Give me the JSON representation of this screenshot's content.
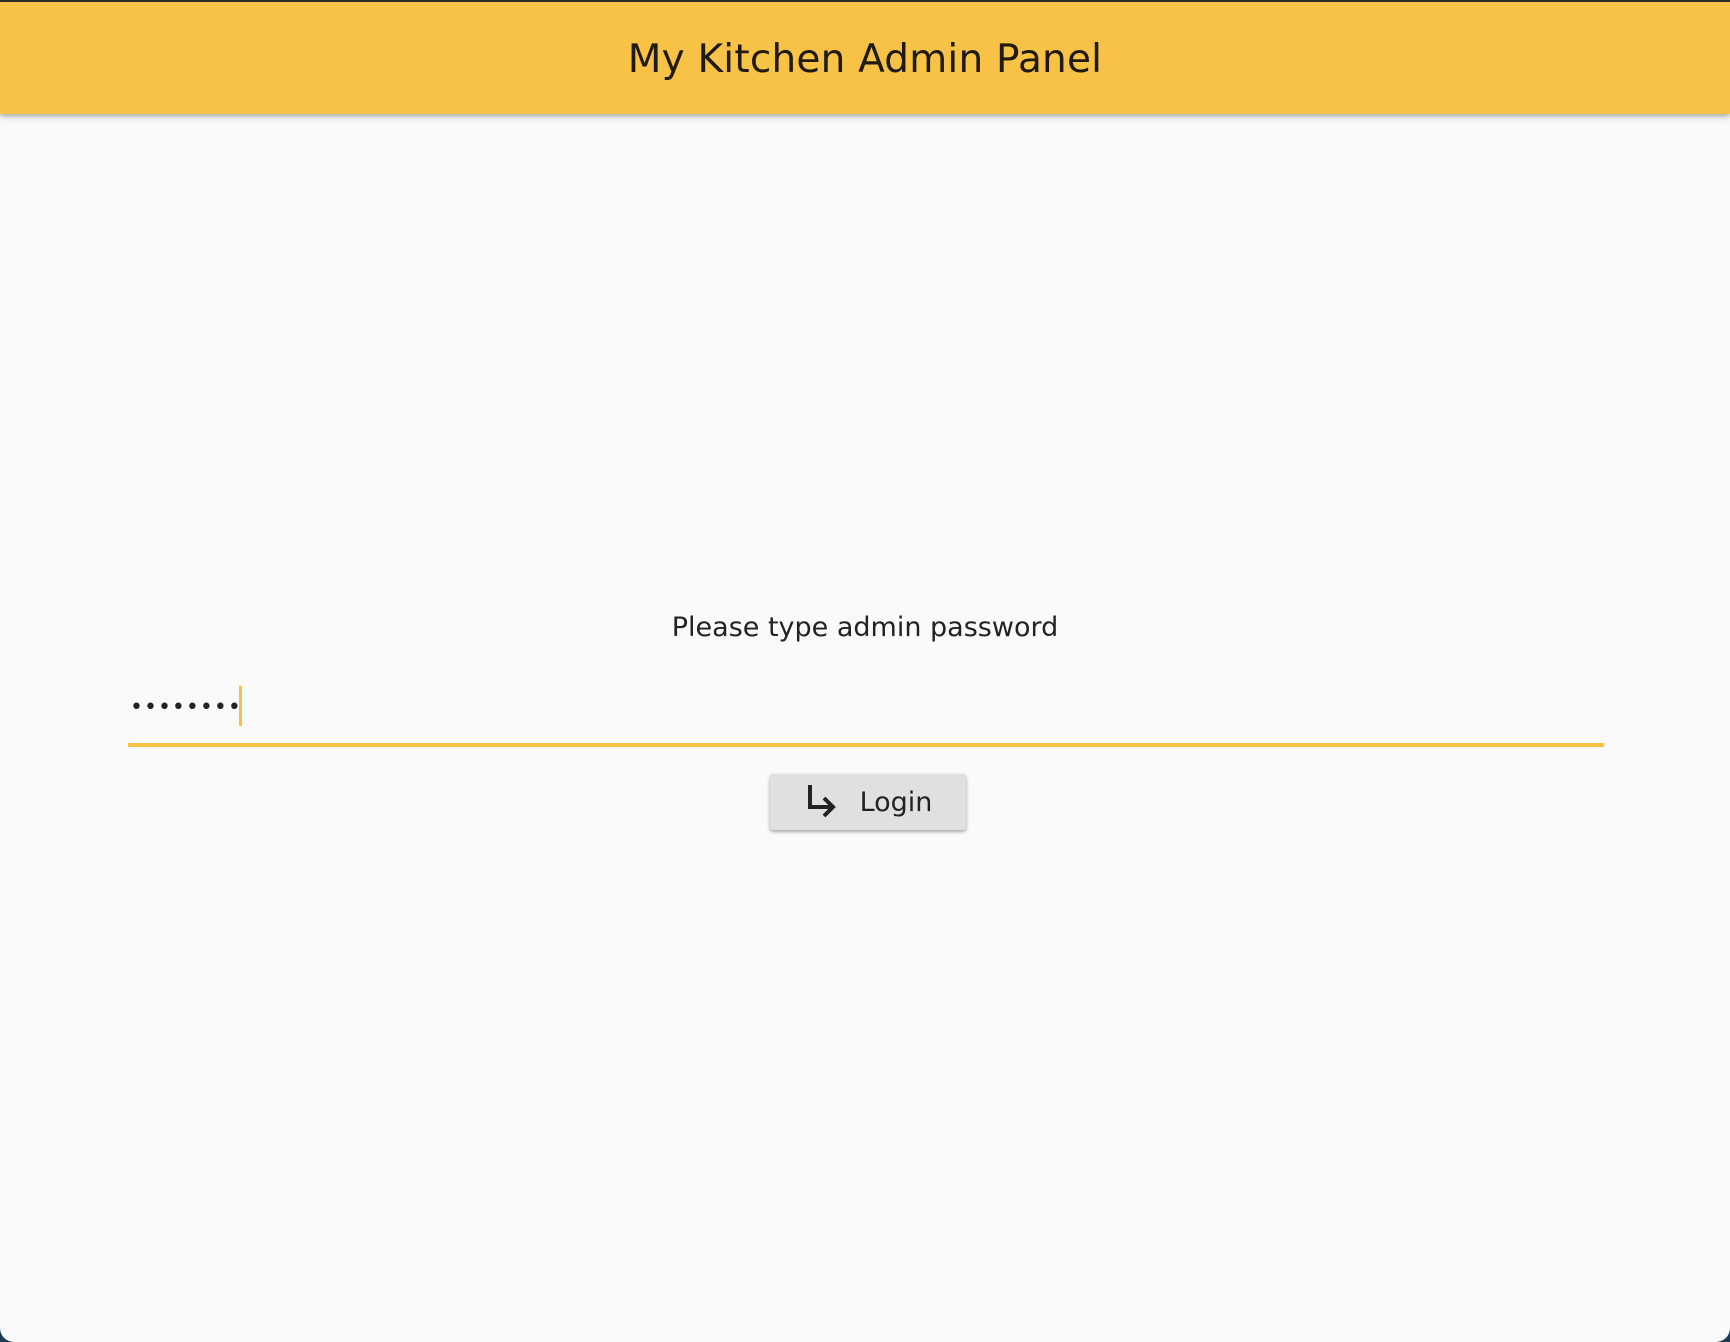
{
  "app_bar": {
    "title": "My Kitchen Admin Panel"
  },
  "login_form": {
    "prompt": "Please type admin password",
    "password_masked": "••••••••",
    "button_label": "Login",
    "button_icon": "subdirectory-arrow-right-icon"
  },
  "colors": {
    "accent": "#f7c245",
    "background": "#fafafa",
    "button": "#e0e0e0"
  }
}
